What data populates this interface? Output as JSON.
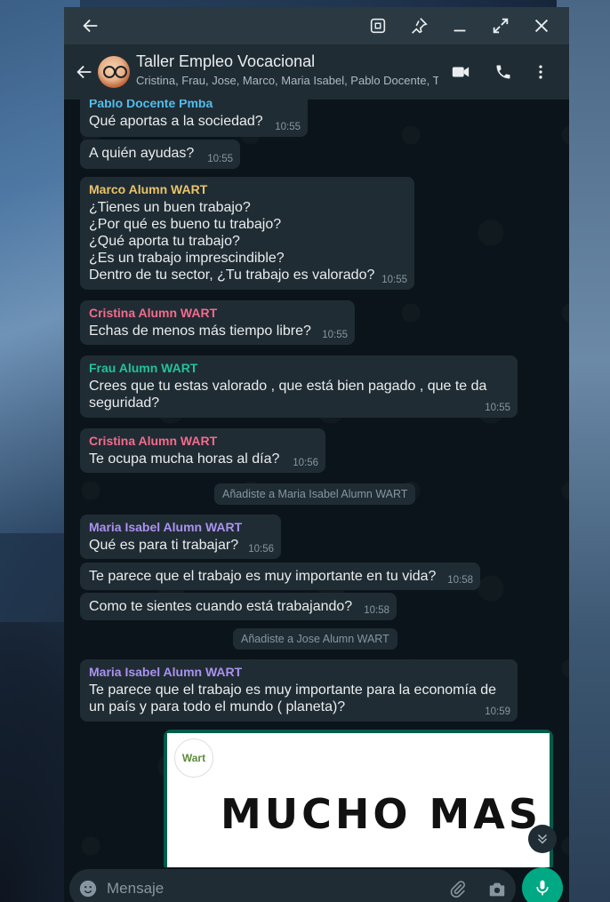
{
  "window": {
    "back_icon": "arrow-left-icon",
    "actions": [
      "screenshot-icon",
      "pin-icon",
      "minimize-icon",
      "maximize-icon",
      "close-icon"
    ]
  },
  "header": {
    "title": "Taller Empleo Vocacional",
    "members": "Cristina, Frau, Jose, Marco, Maria Isabel, Pablo Docente, Tú",
    "actions": [
      "video-call-icon",
      "phone-call-icon",
      "more-vertical-icon"
    ]
  },
  "colors": {
    "pablo": "#53bdeb",
    "marco": "#e9c46a",
    "cristina": "#f56a8e",
    "frau": "#21c39a",
    "maria": "#a992f0",
    "bubble": "#202c33",
    "accent": "#00a884"
  },
  "messages": [
    {
      "sender": "Pablo Docente Pmba",
      "text": "Qué aportas a la sociedad?",
      "time": "10:55"
    },
    {
      "sender": "",
      "text": "A quién ayudas?",
      "time": "10:55"
    },
    {
      "sender": "Marco Alumn WART",
      "lines": [
        "¿Tienes un buen trabajo?",
        "¿Por qué es bueno tu trabajo?",
        "¿Qué aporta tu trabajo?",
        "¿Es un trabajo imprescindible?",
        "Dentro de tu sector, ¿Tu trabajo es valorado?"
      ],
      "time": "10:55"
    },
    {
      "sender": "Cristina Alumn WART",
      "text": "Echas de menos más tiempo libre?",
      "time": "10:55"
    },
    {
      "sender": "Frau Alumn WART",
      "lines": [
        "Crees que tu estas valorado , que está bien pagado , que te da",
        "seguridad?"
      ],
      "time": "10:55"
    },
    {
      "sender": "Cristina Alumn WART",
      "text": "Te ocupa mucha horas al día?",
      "time": "10:56"
    },
    {
      "system": "Añadiste a Maria Isabel Alumn WART"
    },
    {
      "sender": "Maria Isabel Alumn WART",
      "text": "Qué es para ti trabajar?",
      "time": "10:56"
    },
    {
      "sender": "",
      "text": "Te parece que el trabajo es muy importante en tu vida?",
      "time": "10:58"
    },
    {
      "sender": "",
      "text": "Como te sientes cuando está trabajando?",
      "time": "10:58"
    },
    {
      "system": "Añadiste a Jose Alumn WART"
    },
    {
      "sender": "Maria Isabel Alumn WART",
      "lines": [
        "Te parece que el trabajo es muy importante para la economía de",
        "un país y para todo el mundo ( planeta)?"
      ],
      "time": "10:59"
    }
  ],
  "image_message": {
    "logo_text": "Wart",
    "headline": "MUCHO MAS"
  },
  "composer": {
    "placeholder": "Mensaje",
    "icons": [
      "emoji-icon",
      "attach-icon",
      "camera-icon",
      "mic-icon",
      "scroll-down-icon"
    ]
  }
}
